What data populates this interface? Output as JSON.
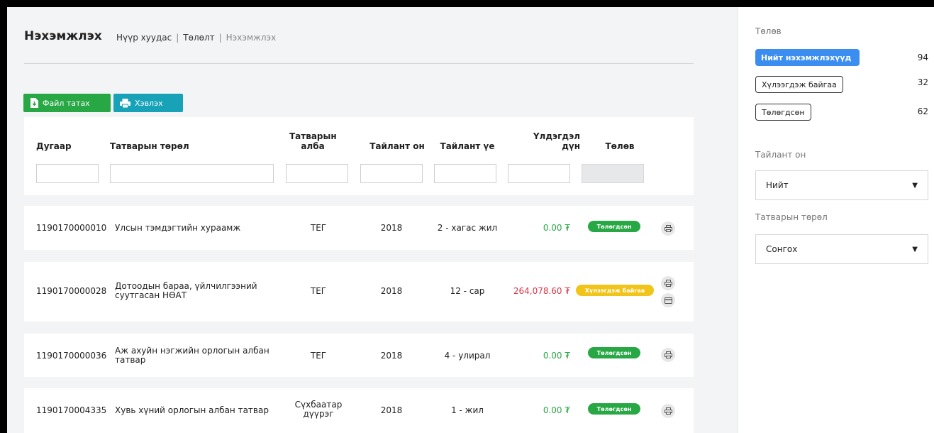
{
  "header": {
    "title": "Нэхэмжлэх",
    "breadcrumb": [
      "Нүүр хуудас",
      "Төлөлт",
      "Нэхэмжлэх"
    ]
  },
  "toolbar": {
    "download_label": "Файл татах",
    "print_label": "Хэвлэх"
  },
  "table": {
    "headers": {
      "number": "Дугаар",
      "tax_type": "Татварын төрөл",
      "tax_office": "Татварын алба",
      "year": "Тайлант он",
      "period": "Тайлант үе",
      "balance": "Үлдэгдэл дүн",
      "status": "Төлөв"
    },
    "rows": [
      {
        "number": "1190170000010",
        "tax_type": "Улсын тэмдэгтийн хураамж",
        "office": "ТЕГ",
        "year": "2018",
        "period": "2 - хагас жил",
        "amount": "0.00 ₮",
        "status": "Төлөгдсөн"
      },
      {
        "number": "1190170000028",
        "tax_type": "Дотоодын бараа, үйлчилгээний суутгасан НӨАТ",
        "office": "ТЕГ",
        "year": "2018",
        "period": "12 - сар",
        "amount": "264,078.60 ₮",
        "status": "Хүлээгдэж байгаа"
      },
      {
        "number": "1190170000036",
        "tax_type": "Аж ахуйн нэгжийн орлогын албан татвар",
        "office": "ТЕГ",
        "year": "2018",
        "period": "4 - улирал",
        "amount": "0.00 ₮",
        "status": "Төлөгдсөн"
      },
      {
        "number": "1190170004335",
        "tax_type": "Хувь хүний орлогын албан татвар",
        "office": "Сүхбаатар дүүрэг",
        "year": "2018",
        "period": "1 - жил",
        "amount": "0.00 ₮",
        "status": "Төлөгдсөн"
      }
    ]
  },
  "sidebar": {
    "status_label": "Төлөв",
    "filters": [
      {
        "label": "Нийт нэхэмжлэхүүд",
        "count": "94"
      },
      {
        "label": "Хүлээгдэж байгаа",
        "count": "32"
      },
      {
        "label": "Төлөгдсөн",
        "count": "62"
      }
    ],
    "year_label": "Тайлант он",
    "year_value": "Нийт",
    "tax_type_label": "Татварын төрөл",
    "tax_type_value": "Сонгох"
  },
  "colors": {
    "green": "#28a745",
    "teal": "#17a2b8",
    "blue": "#3b8ef0",
    "yellow": "#f0c419",
    "red": "#dc3545"
  }
}
